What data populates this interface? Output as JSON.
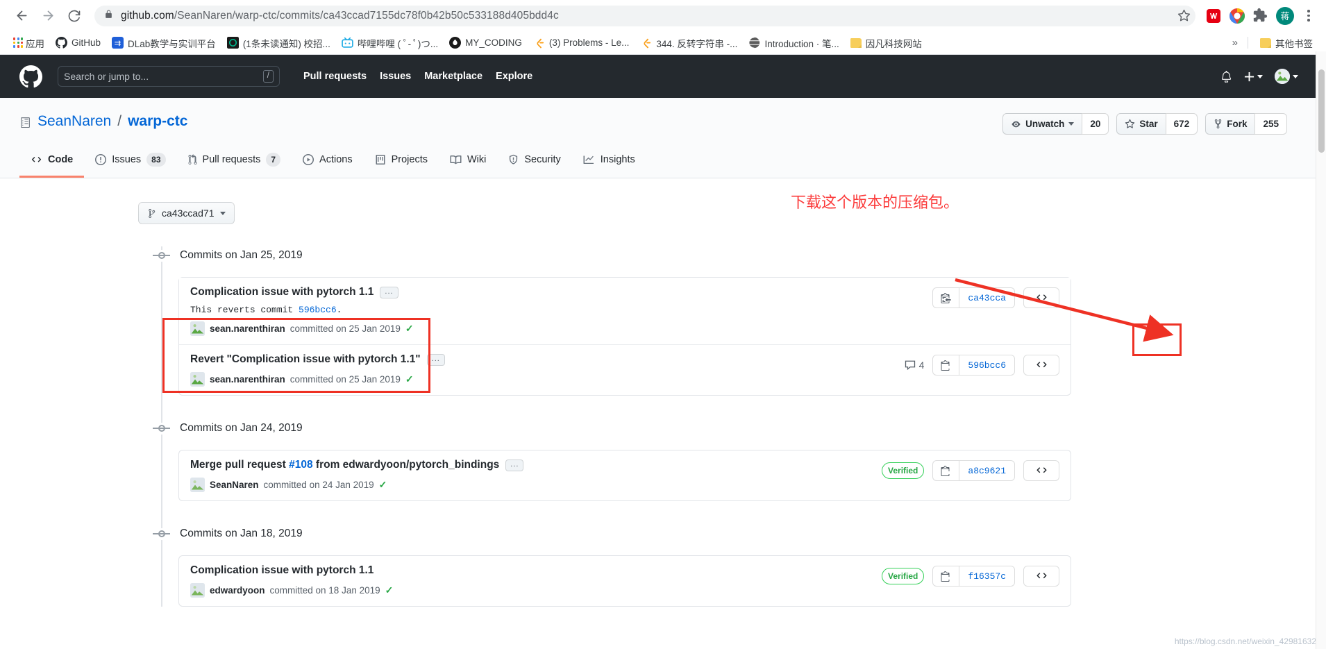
{
  "browser": {
    "url_bold": "github.com",
    "url_rest": "/SeanNaren/warp-ctc/commits/ca43ccad7155dc78f0b42b50c533188d405bdd4c",
    "back_icon": "back-arrow-icon",
    "forward_icon": "forward-arrow-icon",
    "reload_icon": "reload-icon",
    "lock_icon": "lock-icon",
    "star_icon": "bookmark-star-icon",
    "profile_initial": "蒋",
    "bookmarks": [
      {
        "label": "应用",
        "icon": "apps-grid-icon"
      },
      {
        "label": "GitHub",
        "icon": "github-icon"
      },
      {
        "label": "DLab教学与实训平台",
        "icon": "dlab-icon"
      },
      {
        "label": "(1条未读通知) 校招...",
        "icon": "nowcoder-icon"
      },
      {
        "label": "哔哩哔哩 ( ﾟ- ﾟ)つ...",
        "icon": "bilibili-icon"
      },
      {
        "label": "MY_CODING",
        "icon": "mycoding-icon"
      },
      {
        "label": "(3) Problems - Le...",
        "icon": "leetcode-icon"
      },
      {
        "label": "344. 反转字符串 -...",
        "icon": "leetcode-icon"
      },
      {
        "label": "Introduction · 笔...",
        "icon": "gitbook-icon"
      },
      {
        "label": "因凡科技网站",
        "icon": "folder-icon"
      }
    ],
    "overflow_label": "»",
    "other_bookmarks": "其他书签"
  },
  "gh_header": {
    "logo": "github-mark-icon",
    "search_placeholder": "Search or jump to...",
    "search_shortcut": "/",
    "nav": [
      "Pull requests",
      "Issues",
      "Marketplace",
      "Explore"
    ],
    "bell_icon": "notification-bell-icon",
    "plus_icon": "plus-icon",
    "avatar_icon": "user-avatar"
  },
  "repo": {
    "book_icon": "repo-book-icon",
    "owner": "SeanNaren",
    "separator": "/",
    "name": "warp-ctc",
    "actions": [
      {
        "label": "Unwatch",
        "count": "20",
        "icon": "eye-icon",
        "has_caret": true
      },
      {
        "label": "Star",
        "count": "672",
        "icon": "star-icon",
        "has_caret": false
      },
      {
        "label": "Fork",
        "count": "255",
        "icon": "fork-icon",
        "has_caret": false
      }
    ],
    "tabs": [
      {
        "label": "Code",
        "icon": "code-icon",
        "count": null,
        "active": true
      },
      {
        "label": "Issues",
        "icon": "issue-opened-icon",
        "count": "83",
        "active": false
      },
      {
        "label": "Pull requests",
        "icon": "git-pull-request-icon",
        "count": "7",
        "active": false
      },
      {
        "label": "Actions",
        "icon": "play-icon",
        "count": null,
        "active": false
      },
      {
        "label": "Projects",
        "icon": "project-board-icon",
        "count": null,
        "active": false
      },
      {
        "label": "Wiki",
        "icon": "book-icon",
        "count": null,
        "active": false
      },
      {
        "label": "Security",
        "icon": "shield-icon",
        "count": null,
        "active": false
      },
      {
        "label": "Insights",
        "icon": "graph-icon",
        "count": null,
        "active": false
      }
    ]
  },
  "commits_page": {
    "branch_button": {
      "label": "ca43ccad71",
      "icon": "git-branch-icon",
      "caret": true
    },
    "annotation_text": "下载这个版本的压缩包。",
    "watermark": "https://blog.csdn.net/weixin_42981632",
    "groups": [
      {
        "date_header": "Commits on Jan 25, 2019",
        "commits": [
          {
            "title": "Complication issue with pytorch 1.1",
            "ellipsis": "...",
            "description_prefix": "This reverts commit ",
            "description_link": "596bcc6",
            "description_suffix": ".",
            "author": "sean.narenthiran",
            "meta_text": "committed on 25 Jan 2019",
            "verified_check": "✓",
            "verified_badge": null,
            "comments": null,
            "sha": "ca43cca",
            "copy_icon": "clipboard-icon",
            "browse_icon": "code-browse-icon",
            "highlighted": true
          },
          {
            "title": "Revert \"Complication issue with pytorch 1.1\"",
            "ellipsis": "...",
            "description_prefix": null,
            "description_link": null,
            "description_suffix": null,
            "author": "sean.narenthiran",
            "meta_text": "committed on 25 Jan 2019",
            "verified_check": "✓",
            "verified_badge": null,
            "comments": "4",
            "sha": "596bcc6",
            "copy_icon": "clipboard-icon",
            "browse_icon": "code-browse-icon",
            "highlighted": false
          }
        ]
      },
      {
        "date_header": "Commits on Jan 24, 2019",
        "commits": [
          {
            "title_prefix": "Merge pull request ",
            "title_link": "#108",
            "title_suffix": " from edwardyoon/pytorch_bindings",
            "ellipsis": "...",
            "description_prefix": null,
            "description_link": null,
            "description_suffix": null,
            "author": "SeanNaren",
            "meta_text": "committed on 24 Jan 2019",
            "verified_check": "✓",
            "verified_badge": "Verified",
            "comments": null,
            "sha": "a8c9621",
            "copy_icon": "clipboard-icon",
            "browse_icon": "code-browse-icon",
            "highlighted": false
          }
        ]
      },
      {
        "date_header": "Commits on Jan 18, 2019",
        "commits": [
          {
            "title": "Complication issue with pytorch 1.1",
            "ellipsis": null,
            "description_prefix": null,
            "description_link": null,
            "description_suffix": null,
            "author": "edwardyoon",
            "meta_text": "committed on 18 Jan 2019",
            "verified_check": "✓",
            "verified_badge": "Verified",
            "comments": null,
            "sha": "f16357c",
            "copy_icon": "clipboard-icon",
            "browse_icon": "code-browse-icon",
            "highlighted": false
          }
        ]
      }
    ]
  },
  "colors": {
    "accent_blue": "#0366d6",
    "header_dark": "#24292e",
    "annotation_red": "#ee3124",
    "verified_green": "#28a745",
    "tab_active": "#f9826c"
  }
}
